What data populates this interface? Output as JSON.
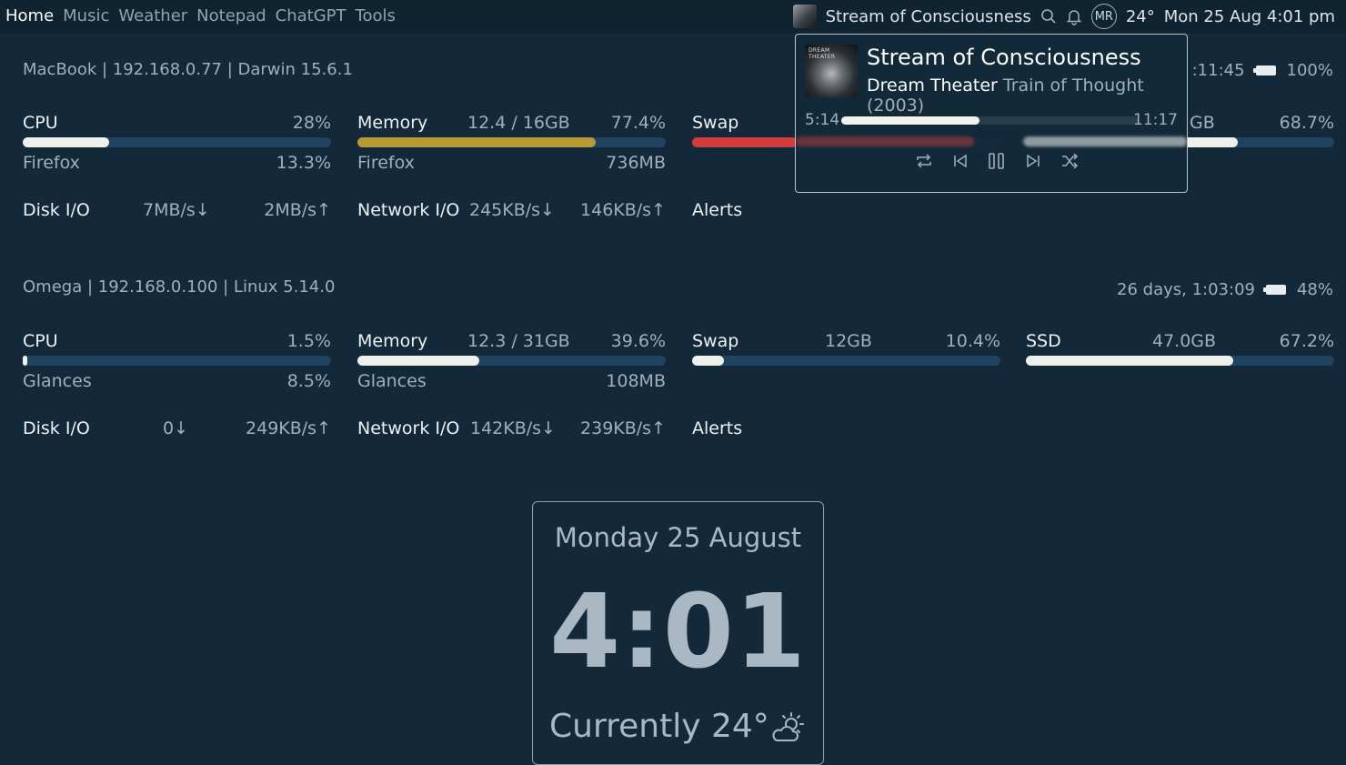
{
  "nav": {
    "tabs": [
      {
        "label": "Home",
        "active": true
      },
      {
        "label": "Music",
        "active": false
      },
      {
        "label": "Weather",
        "active": false
      },
      {
        "label": "Notepad",
        "active": false
      },
      {
        "label": "ChatGPT",
        "active": false
      },
      {
        "label": "Tools",
        "active": false
      }
    ]
  },
  "topbar": {
    "now_playing_title": "Stream of Consciousness",
    "avatar_initials": "MR",
    "temperature": "24°",
    "datetime": "Mon 25 Aug 4:01 pm"
  },
  "macbook": {
    "header": "MacBook | 192.168.0.77 | Darwin 15.6.1",
    "uptime": ":11:45",
    "battery": "100%",
    "battery_level": 1.0,
    "cpu": {
      "label": "CPU",
      "percent": "28%",
      "fill": 0.28,
      "process": "Firefox",
      "process_value": "13.3%"
    },
    "memory": {
      "label": "Memory",
      "detail": "12.4 / 16GB",
      "percent": "77.4%",
      "fill": 0.774,
      "color": "#b89a35",
      "process": "Firefox",
      "process_value": "736MB"
    },
    "swap": {
      "label": "Swap",
      "color": "#d23c3a"
    },
    "disk": {
      "partial_detail": "GB",
      "percent": "68.7%",
      "fill": 0.687
    },
    "disk_io": {
      "label": "Disk I/O",
      "down": "7MB/s↓",
      "up": "2MB/s↑"
    },
    "network_io": {
      "label": "Network I/O",
      "down": "245KB/s↓",
      "up": "146KB/s↑"
    },
    "alerts": "Alerts"
  },
  "omega": {
    "header": "Omega | 192.168.0.100 | Linux 5.14.0",
    "uptime": "26 days, 1:03:09",
    "battery": "48%",
    "battery_level": 0.48,
    "cpu": {
      "label": "CPU",
      "percent": "1.5%",
      "fill": 0.015,
      "process": "Glances",
      "process_value": "8.5%"
    },
    "memory": {
      "label": "Memory",
      "detail": "12.3 / 31GB",
      "percent": "39.6%",
      "fill": 0.396,
      "process": "Glances",
      "process_value": "108MB"
    },
    "swap": {
      "label": "Swap",
      "detail": "12GB",
      "percent": "10.4%",
      "fill": 0.104
    },
    "ssd": {
      "label": "SSD",
      "detail": "47.0GB",
      "percent": "67.2%",
      "fill": 0.672
    },
    "disk_io": {
      "label": "Disk I/O",
      "down": "0↓",
      "up": "249KB/s↑"
    },
    "network_io": {
      "label": "Network I/O",
      "down": "142KB/s↓",
      "up": "239KB/s↑"
    },
    "alerts": "Alerts"
  },
  "clock": {
    "date": "Monday 25 August",
    "time": "4:01",
    "weather": "Currently 24°",
    "weather_icon": "partly-sunny-icon"
  },
  "player": {
    "album_art_text": "DREAM THEATER",
    "title": "Stream of Consciousness",
    "artist": "Dream Theater",
    "album": "Train of Thought (2003)",
    "elapsed": "5:14",
    "total": "11:17",
    "progress": 0.465,
    "controls": [
      "repeat-icon",
      "previous-icon",
      "pause-icon",
      "next-icon",
      "shuffle-icon"
    ]
  }
}
